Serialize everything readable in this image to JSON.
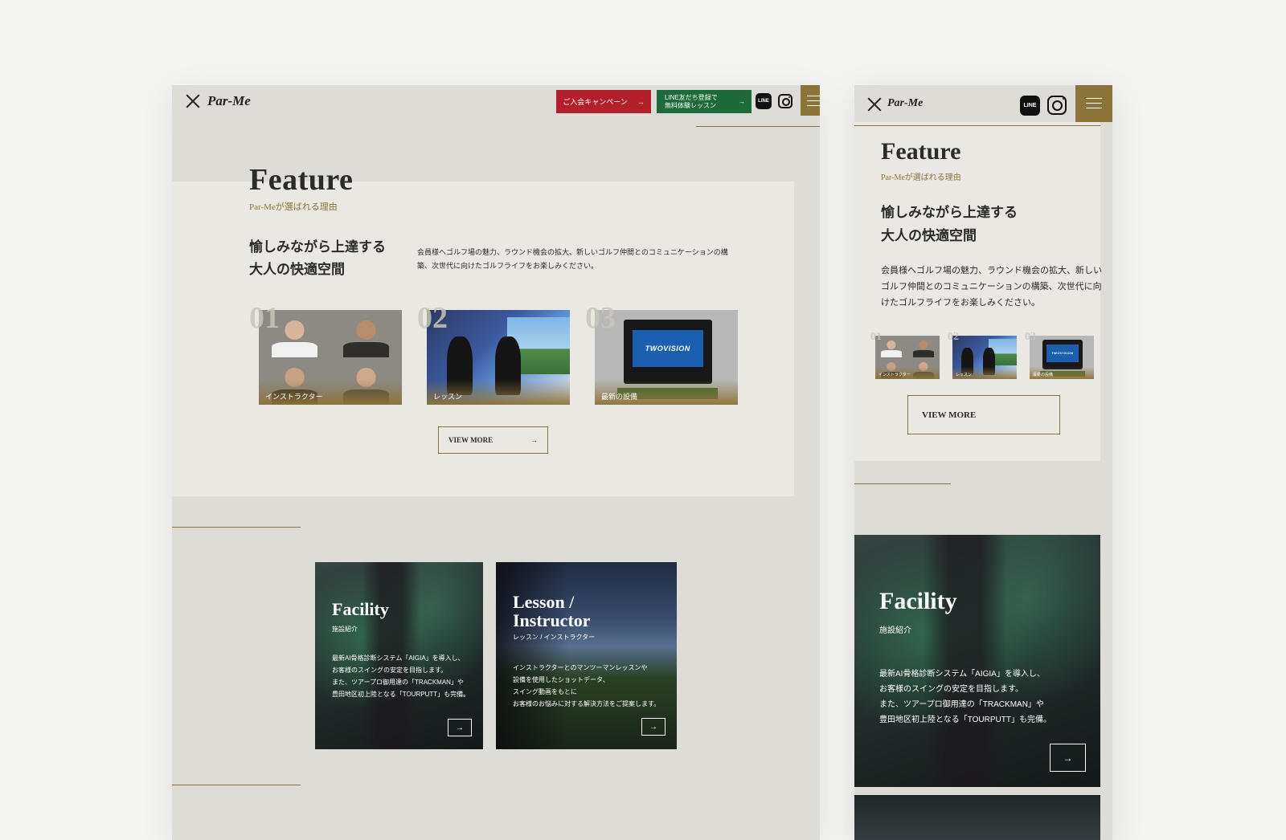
{
  "brand": {
    "name": "Par-Me"
  },
  "colors": {
    "gold": "#8c733a",
    "red": "#b3202b",
    "green": "#1d6b3a",
    "background": "#dedcd6",
    "panel": "#eae8e3"
  },
  "header": {
    "campaign_label": "ご入会キャンペーン",
    "line_label_1": "LINE友だち登録で",
    "line_label_2": "無料体験レッスン",
    "line_icon_text": "LINE",
    "arrow": "→"
  },
  "feature": {
    "title": "Feature",
    "subtitle": "Par-Meが選ばれる理由",
    "catch_line1": "愉しみながら上達する",
    "catch_line2": "大人の快適空間",
    "description": "会員様へゴルフ場の魅力、ラウンド機会の拡大、新しいゴルフ仲間とのコミュニケーションの構築、次世代に向けたゴルフライフをお楽しみください。",
    "cards": [
      {
        "num": "01",
        "label": "インストラクター"
      },
      {
        "num": "02",
        "label": "レッスン"
      },
      {
        "num": "03",
        "label": "最新の設備",
        "screen_text": "TWOVISION"
      }
    ],
    "view_more": "VIEW MORE"
  },
  "facility": {
    "title": "Facility",
    "subtitle": "施設紹介",
    "lines": [
      "最新AI骨格診断システム「AIGIA」を導入し、",
      "お客様のスイングの安定を目指します。",
      "また、ツアープロ御用達の「TRACKMAN」や",
      "豊田地区初上陸となる「TOURPUTT」も完備。"
    ]
  },
  "lesson": {
    "title_line1": "Lesson /",
    "title_line2": "Instructor",
    "subtitle": "レッスン / インストラクター",
    "lines": [
      "インストラクターとのマンツーマンレッスンや",
      "設備を使用したショットデータ、",
      "スイング動画をもとに",
      "お客様のお悩みに対する解決方法をご提案します。"
    ]
  }
}
